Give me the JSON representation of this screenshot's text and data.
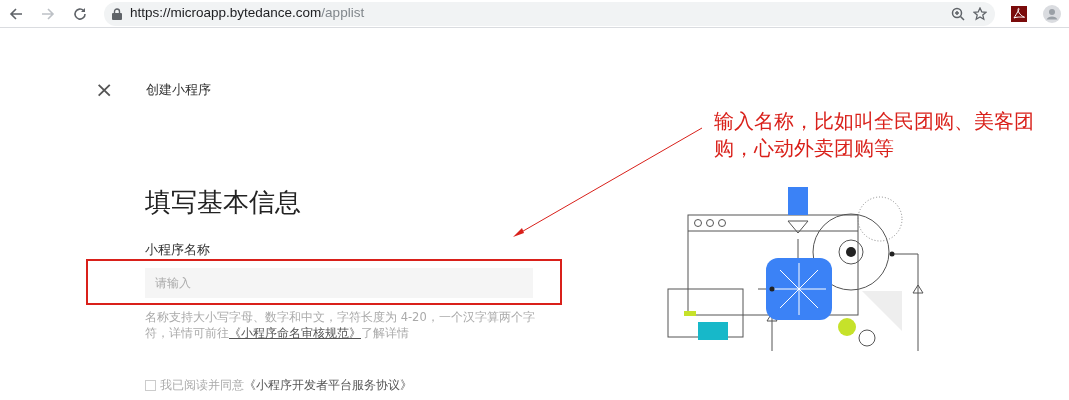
{
  "browser": {
    "url_host": "https://microapp.bytedance.com",
    "url_path": "/applist"
  },
  "header": {
    "close": "×",
    "title": "创建小程序"
  },
  "form": {
    "heading": "填写基本信息",
    "field_label": "小程序名称",
    "placeholder": "请输入",
    "help": {
      "before": "名称支持大小写字母、数字和中文，字符长度为 4-20，一个汉字算两个字符，详情可前往",
      "link": "《小程序命名审核规范》",
      "after": "了解详情"
    },
    "agreement": {
      "checked": false,
      "text": "我已阅读并同意",
      "link": "《小程序开发者平台服务协议》"
    }
  },
  "annotation": {
    "text": "输入名称，比如叫全民团购、美客团购，心动外卖团购等"
  }
}
